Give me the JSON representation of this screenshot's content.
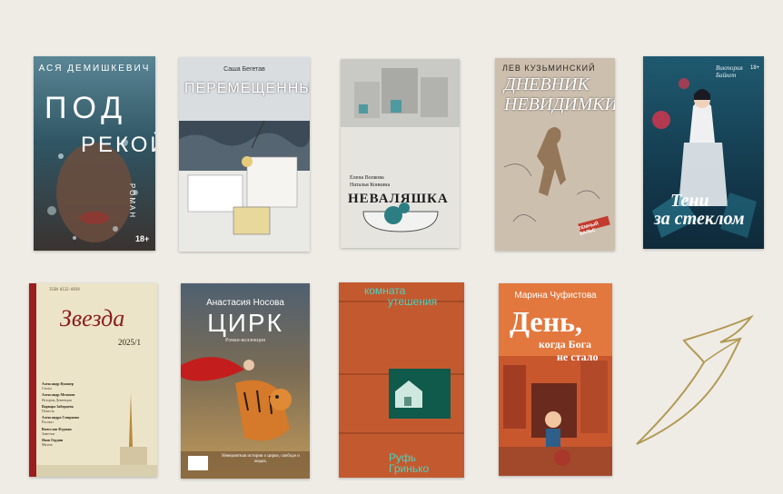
{
  "books": [
    {
      "author": "АСЯ ДЕМИШКЕВИЧ",
      "title_line1": "ПОД",
      "title_line2": "РЕКОЙ",
      "genre": "РОМАН",
      "age": "18+",
      "bg": "#3f6a7a"
    },
    {
      "author": "Саша Бегетав",
      "title": "Перемещенные",
      "bg": "#d9dde0"
    },
    {
      "author_1": "Елена Волкова",
      "author_2": "Наталья Конкина",
      "title": "НЕВАЛЯШКА",
      "bg": "#e6e4df"
    },
    {
      "author": "ЛЕВ КУЗЬМИНСКИЙ",
      "title_line1": "Дневник",
      "title_line2": "Невидимки",
      "tag": "тёмный вальс",
      "bg": "#cbbfb0"
    },
    {
      "author": "Виктория Байкет",
      "title_line1": "Тени",
      "title_line2": "за стеклом",
      "age": "18+",
      "bg": "#1b4c63"
    },
    {
      "masthead_small": "ISSN 0132-0939",
      "title": "Звезда",
      "issue": "2025/1",
      "contents": [
        "Александр Кушнер",
        "Стихи",
        "Александр Мелихов",
        "История Деменции",
        "Варвара Заборцева",
        "Повесть",
        "Александра Смирнова",
        "Рассказ",
        "Вячеслав Фурман",
        "Заметки",
        "Яков Гордин",
        "Мятеж"
      ],
      "bg": "#ece4c8"
    },
    {
      "author": "Анастасия Носова",
      "title": "ЦИРК",
      "subtitle": "Роман-коллекция",
      "blurb": "Невероятная история о цирке, свободе и людях.",
      "bg": "#8f6e48"
    },
    {
      "title_line1": "комната",
      "title_line2": "утешения",
      "author_line1": "Руфь",
      "author_line2": "Гринько",
      "bg": "#c35a2f"
    },
    {
      "author": "Марина Чуфистова",
      "title_line1": "День,",
      "title_line2": "когда Бога",
      "title_line3": "не стало",
      "bg": "#e2783e"
    }
  ],
  "colors": {
    "page_bg": "#efece6",
    "ornament": "#b19a55"
  },
  "ornament_icon": "ribbon-flourish-icon"
}
